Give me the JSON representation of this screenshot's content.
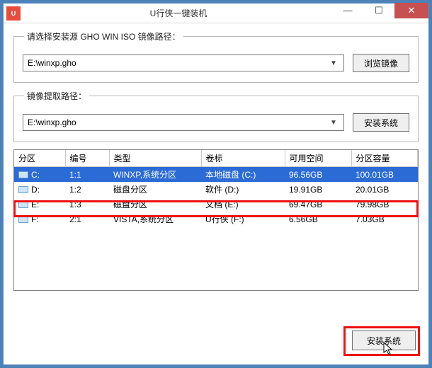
{
  "window": {
    "title": "U行侠一键装机",
    "app_icon_text": "U"
  },
  "group1": {
    "legend": "请选择安装源 GHO WIN ISO 镜像路径：",
    "select_value": "E:\\winxp.gho",
    "browse_label": "浏览镜像"
  },
  "group2": {
    "legend": "镜像提取路径：",
    "select_value": "E:\\winxp.gho",
    "install_label": "安装系统"
  },
  "table": {
    "headers": {
      "partition": "分区",
      "number": "编号",
      "type": "类型",
      "label": "卷标",
      "free": "可用空间",
      "capacity": "分区容量"
    },
    "rows": [
      {
        "partition": "C:",
        "number": "1:1",
        "type": "WINXP,系统分区",
        "label": "本地磁盘 (C:)",
        "free": "96.56GB",
        "capacity": "100.01GB",
        "selected": true
      },
      {
        "partition": "D:",
        "number": "1:2",
        "type": "磁盘分区",
        "label": "软件 (D:)",
        "free": "19.91GB",
        "capacity": "20.01GB",
        "selected": false
      },
      {
        "partition": "E:",
        "number": "1:3",
        "type": "磁盘分区",
        "label": "文档 (E:)",
        "free": "69.47GB",
        "capacity": "79.98GB",
        "selected": false
      },
      {
        "partition": "F:",
        "number": "2:1",
        "type": "VISTA,系统分区",
        "label": "U行侠 (F:)",
        "free": "6.56GB",
        "capacity": "7.03GB",
        "selected": false
      }
    ]
  },
  "footer": {
    "install_label": "安装系统"
  }
}
